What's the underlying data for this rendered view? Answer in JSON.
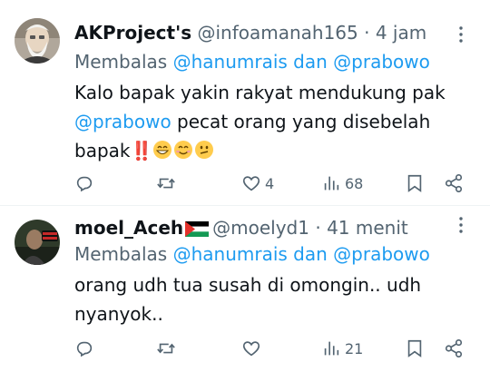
{
  "tweets": [
    {
      "name": "AKProject's",
      "handle": "@infoamanah165",
      "dot": " · ",
      "time": "4 jam",
      "replying_prefix": "Membalas ",
      "replying_user1": "@hanumrais",
      "replying_and": " dan ",
      "replying_user2": "@prabowo",
      "text_part1": "Kalo bapak yakin rakyat mendukung pak ",
      "text_mention": "@prabowo",
      "text_part2": " pecat orang yang disebelah bapak",
      "text_emoji": "‼️",
      "likes": "4",
      "views": "68"
    },
    {
      "name": "moel_Aceh",
      "flag": "Palestine flag",
      "handle": "@moelyd1",
      "dot": " · ",
      "time": "41 menit",
      "replying_prefix": "Membalas ",
      "replying_user1": "@hanumrais",
      "replying_and": " dan ",
      "replying_user2": "@prabowo",
      "text_part1": "orang udh tua susah di omongin.. udh nyanyok..",
      "likes": "",
      "views": "21"
    }
  ],
  "icons": [
    "reply-icon",
    "retweet-icon",
    "like-icon",
    "views-icon",
    "bookmark-icon",
    "share-icon",
    "more-icon"
  ],
  "colors": {
    "accent": "#1d9bf0",
    "muted": "#536471",
    "text": "#0f1419"
  }
}
